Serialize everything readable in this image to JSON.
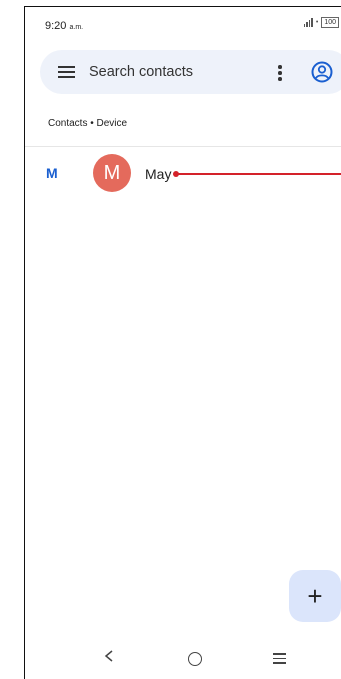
{
  "status_bar": {
    "time": "9:20",
    "time_suffix": "a.m.",
    "battery": "100"
  },
  "search": {
    "placeholder": "Search contacts"
  },
  "section": {
    "label": "Contacts • Device"
  },
  "contacts": [
    {
      "letter_header": "M",
      "initial": "M",
      "name": "May",
      "avatar_color": "#e46a5c"
    }
  ],
  "fab": {
    "label": "+"
  },
  "colors": {
    "accent": "#1a5fd0",
    "search_bg": "#eef2fa",
    "fab_bg": "#dbe5fb",
    "pointer": "#d4222a"
  }
}
